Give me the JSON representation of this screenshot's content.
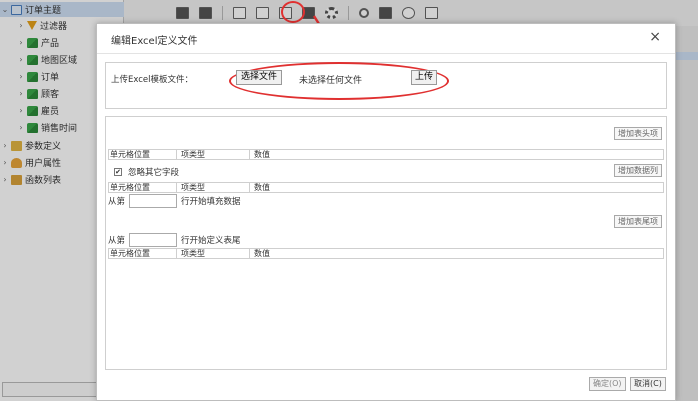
{
  "tree": {
    "items": [
      {
        "label": "订单主题",
        "icon": "subject-icon",
        "expanded": true,
        "level": 0
      },
      {
        "label": "过滤器",
        "icon": "filter-icon",
        "expanded": false,
        "level": 1
      },
      {
        "label": "产品",
        "icon": "cube-icon",
        "expanded": false,
        "level": 1
      },
      {
        "label": "地图区域",
        "icon": "cube-icon",
        "expanded": false,
        "level": 1
      },
      {
        "label": "订单",
        "icon": "cube-icon",
        "expanded": false,
        "level": 1
      },
      {
        "label": "顾客",
        "icon": "cube-icon",
        "expanded": false,
        "level": 1
      },
      {
        "label": "雇员",
        "icon": "cube-icon",
        "expanded": false,
        "level": 1
      },
      {
        "label": "销售时间",
        "icon": "cube-icon",
        "expanded": false,
        "level": 1
      },
      {
        "label": "参数定义",
        "icon": "param-icon",
        "expanded": false,
        "level": 0
      },
      {
        "label": "用户属性",
        "icon": "user-icon",
        "expanded": false,
        "level": 0
      },
      {
        "label": "函数列表",
        "icon": "function-icon",
        "expanded": false,
        "level": 0
      }
    ]
  },
  "toolbar": {
    "icons": [
      "save-icon",
      "save-as-icon",
      "sep",
      "table-icon",
      "form-icon",
      "text-icon",
      "excel-definition-icon",
      "gear-icon",
      "sep",
      "search-icon",
      "sql-icon",
      "clock-icon",
      "calendar-icon"
    ]
  },
  "dialog": {
    "title": "编辑Excel定义文件",
    "close": "×",
    "upload": {
      "label": "上传Excel模板文件：",
      "choose_button": "选择文件",
      "no_file_text": "未选择任何文件",
      "upload_button": "上传"
    },
    "header_section": {
      "add_button": "增加表头项",
      "columns": [
        "单元格位置",
        "项类型",
        "数值"
      ]
    },
    "data_section": {
      "ignore_checkbox": "忽略其它字段",
      "ignore_checked": true,
      "add_button": "增加数据列",
      "columns": [
        "单元格位置",
        "项类型",
        "数值"
      ],
      "from_label": "从第",
      "from_value": "",
      "from_suffix": "行开始填充数据"
    },
    "footer_section": {
      "add_button": "增加表尾项",
      "from_label": "从第",
      "from_value": "",
      "from_suffix": "行开始定义表尾",
      "columns": [
        "单元格位置",
        "项类型",
        "数值"
      ]
    },
    "ok_button": "确定(O)",
    "cancel_button": "取消(C)"
  },
  "colors": {
    "highlight": "#e03030",
    "selected_row": "#cfe0f5"
  }
}
